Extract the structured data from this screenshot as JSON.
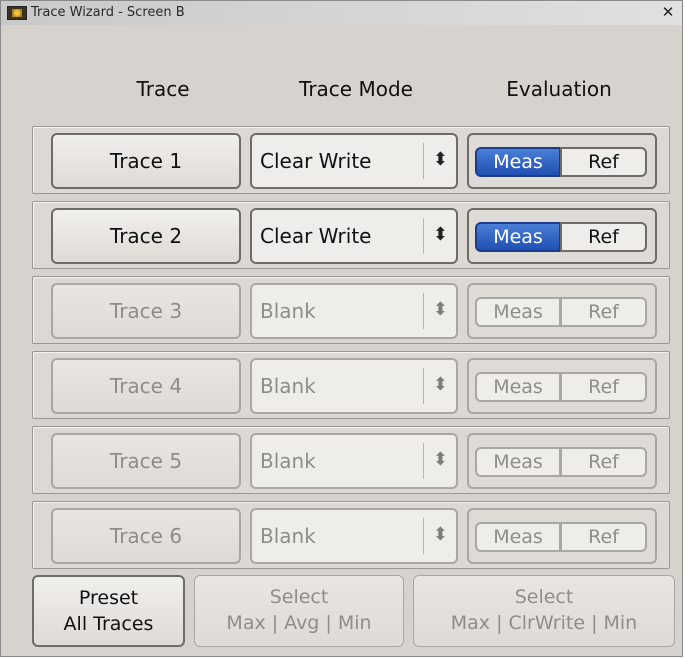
{
  "window": {
    "title": "Trace Wizard - Screen B",
    "close_label": "✕"
  },
  "headers": {
    "trace": "Trace",
    "trace_mode": "Trace Mode",
    "evaluation": "Evaluation"
  },
  "rows": [
    {
      "trace": "Trace 1",
      "mode": "Clear Write",
      "meas": "Meas",
      "ref": "Ref",
      "enabled": true,
      "meas_active": true
    },
    {
      "trace": "Trace 2",
      "mode": "Clear Write",
      "meas": "Meas",
      "ref": "Ref",
      "enabled": true,
      "meas_active": true
    },
    {
      "trace": "Trace 3",
      "mode": "Blank",
      "meas": "Meas",
      "ref": "Ref",
      "enabled": false,
      "meas_active": false
    },
    {
      "trace": "Trace 4",
      "mode": "Blank",
      "meas": "Meas",
      "ref": "Ref",
      "enabled": false,
      "meas_active": false
    },
    {
      "trace": "Trace 5",
      "mode": "Blank",
      "meas": "Meas",
      "ref": "Ref",
      "enabled": false,
      "meas_active": false
    },
    {
      "trace": "Trace 6",
      "mode": "Blank",
      "meas": "Meas",
      "ref": "Ref",
      "enabled": false,
      "meas_active": false
    }
  ],
  "bottom": {
    "preset": {
      "line1": "Preset",
      "line2": "All Traces"
    },
    "select_avg": {
      "line1": "Select",
      "line2": "Max | Avg | Min"
    },
    "select_clr": {
      "line1": "Select",
      "line2": "Max | ClrWrite | Min"
    }
  },
  "colors": {
    "active_meas": "#1f4fb3",
    "background": "#d6d3ce"
  }
}
